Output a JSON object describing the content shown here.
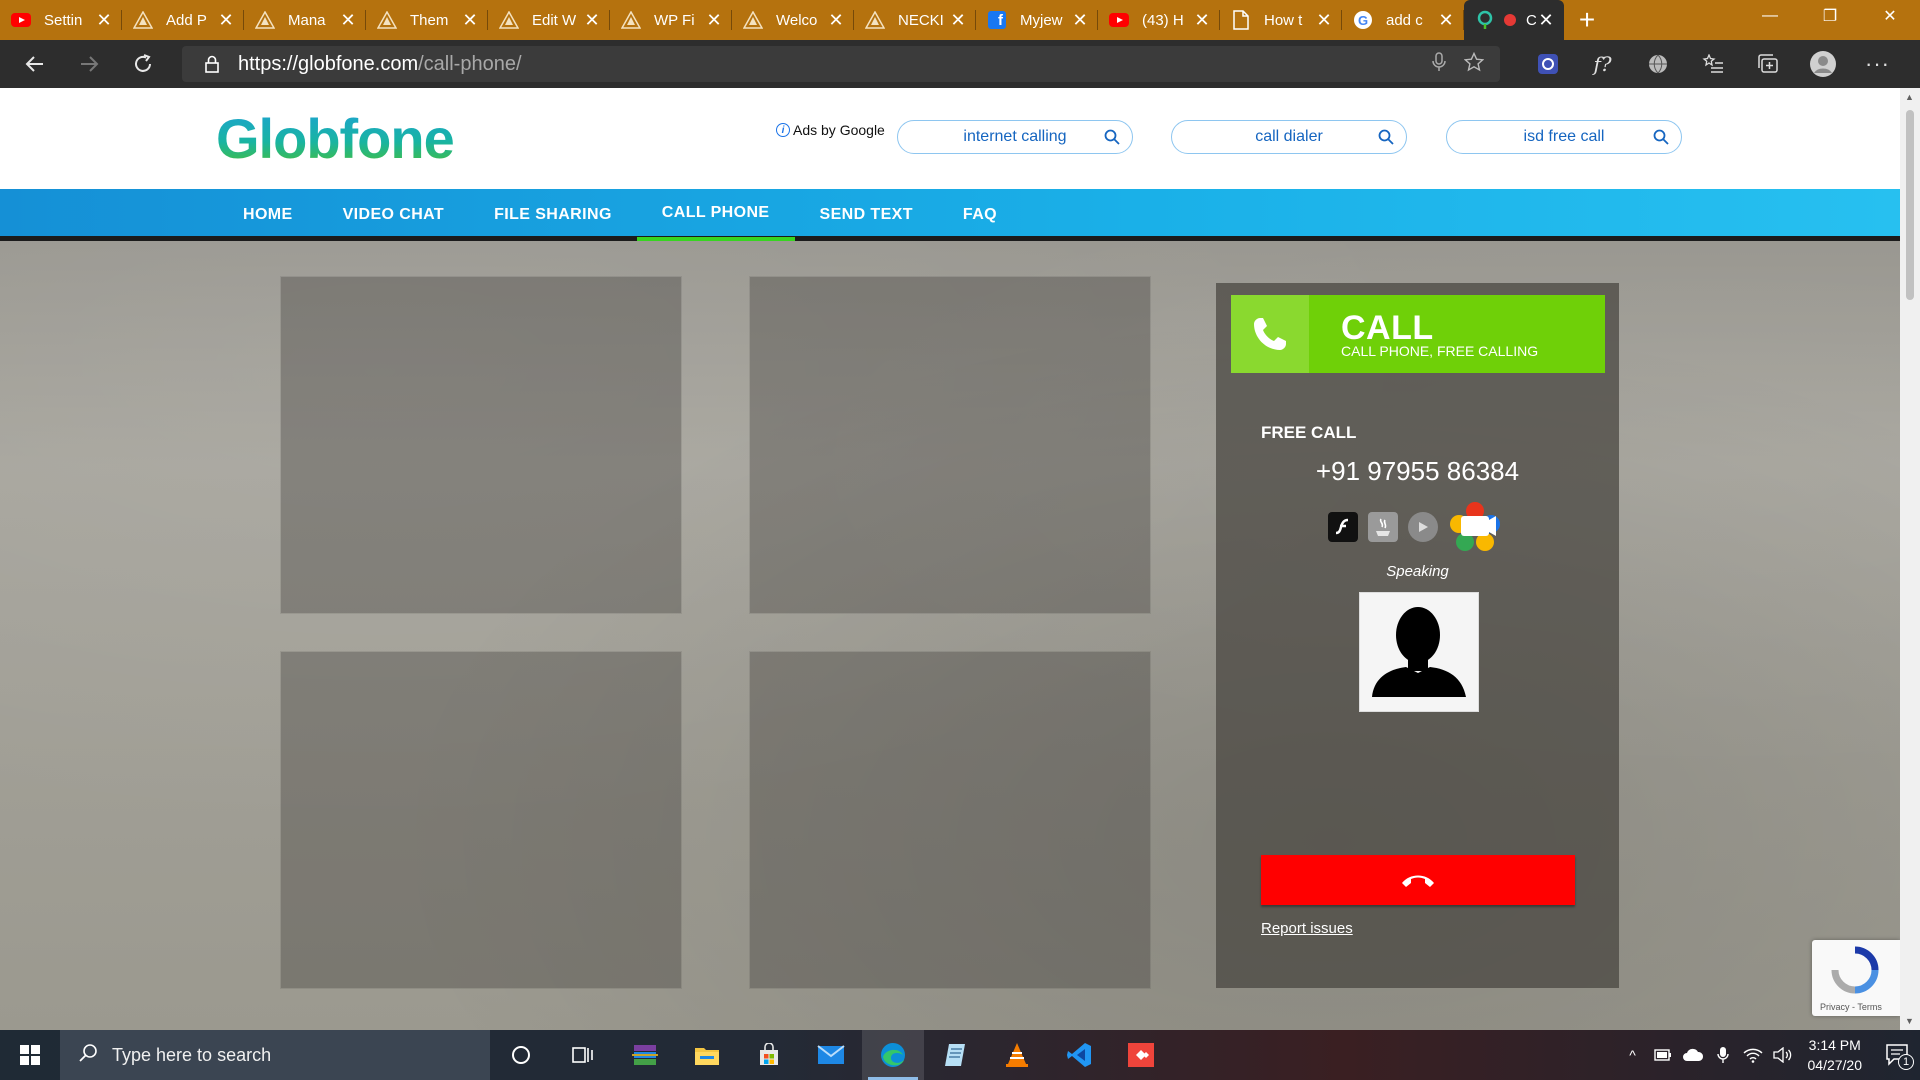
{
  "browser": {
    "tabs": [
      {
        "label": "Settin",
        "favicon": "youtube-icon"
      },
      {
        "label": "Add P",
        "favicon": "wordpress-triangle-icon"
      },
      {
        "label": "Mana",
        "favicon": "wordpress-triangle-icon"
      },
      {
        "label": "Them",
        "favicon": "wordpress-triangle-icon"
      },
      {
        "label": "Edit W",
        "favicon": "wordpress-triangle-icon"
      },
      {
        "label": "WP Fi",
        "favicon": "wordpress-triangle-icon"
      },
      {
        "label": "Welco",
        "favicon": "wordpress-triangle-icon"
      },
      {
        "label": "NECKI",
        "favicon": "wordpress-triangle-icon"
      },
      {
        "label": "Myjew",
        "favicon": "facebook-icon"
      },
      {
        "label": "(43) H",
        "favicon": "youtube-icon"
      },
      {
        "label": "How t",
        "favicon": "document-icon"
      },
      {
        "label": "add c",
        "favicon": "google-icon"
      },
      {
        "label": "C",
        "favicon": "globfone-icon",
        "active": true
      }
    ],
    "url": {
      "host": "https://globfone.com",
      "path": "/call-phone/"
    },
    "colors": {
      "tabbar": "#b5720e",
      "toolbar": "#2d2d2d"
    }
  },
  "site": {
    "logo": "Globfone",
    "ads_label": "Ads by Google",
    "ad_searches": [
      "internet calling",
      "call dialer",
      "isd free call"
    ],
    "nav": [
      "HOME",
      "VIDEO CHAT",
      "FILE SHARING",
      "CALL PHONE",
      "SEND TEXT",
      "FAQ"
    ],
    "nav_active": "CALL PHONE",
    "colors": {
      "nav": "#1a9fe0",
      "nav_active_underline": "#37d420",
      "call_green": "#6fd008",
      "hangup_red": "#ff0000"
    }
  },
  "call": {
    "title": "CALL",
    "subtitle": "CALL PHONE, FREE CALLING",
    "free_call_label": "FREE CALL",
    "number": "+91 97955 86384",
    "status": "Speaking",
    "report_link": "Report issues",
    "tech_icons": [
      "flash-icon",
      "java-icon",
      "webrtc-mic-icon",
      "webrtc-logo-icon"
    ]
  },
  "recaptcha": {
    "text": "Privacy - Terms"
  },
  "taskbar": {
    "search_placeholder": "Type here to search",
    "time": "3:14 PM",
    "date": "04/27/20",
    "notification_count": "1"
  }
}
